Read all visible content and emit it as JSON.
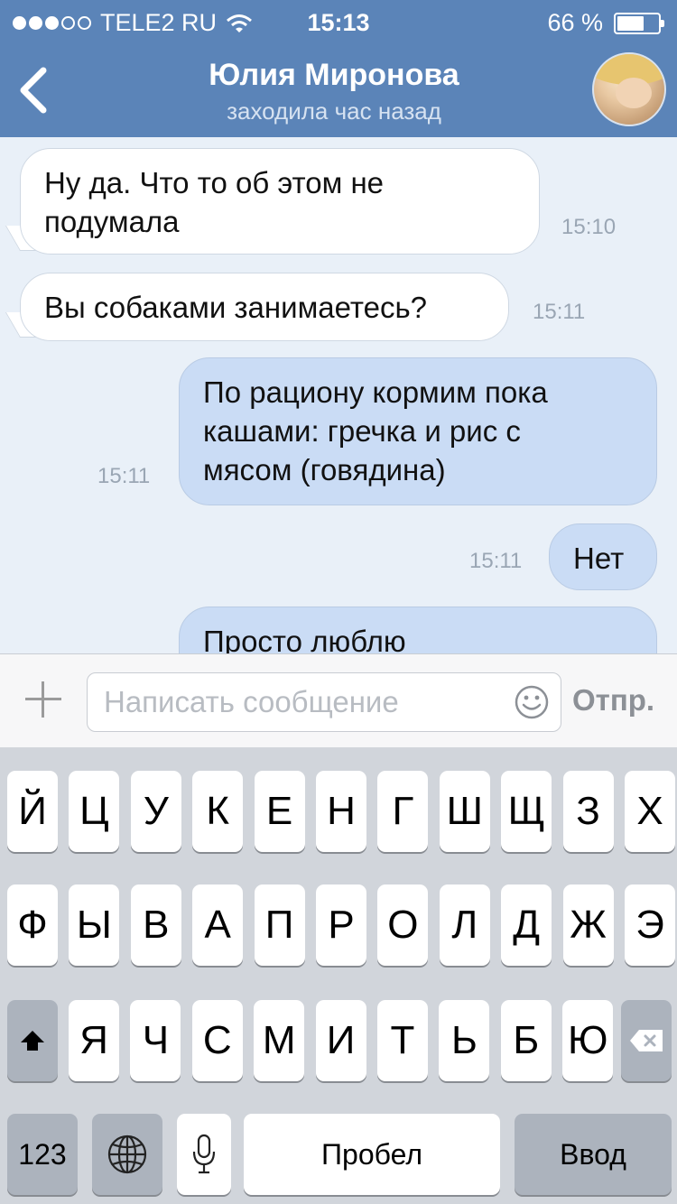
{
  "status_bar": {
    "carrier": "TELE2 RU",
    "time": "15:13",
    "battery": "66 %",
    "signal_filled": 3,
    "signal_total": 5,
    "battery_level": 0.66
  },
  "header": {
    "back_icon": "chevron-left-icon",
    "name": "Юлия Миронова",
    "last_seen": "заходила час назад",
    "accent": "#5b84b8"
  },
  "messages": [
    {
      "direction": "in",
      "lines": [
        "Ну да. Что то об этом не",
        "подумала"
      ],
      "time": "15:10"
    },
    {
      "direction": "in",
      "lines": [
        "Вы собаками занимаетесь?"
      ],
      "time": "15:11"
    },
    {
      "direction": "out",
      "lines": [
        "По рациону кормим пока",
        "кашами: гречка и рис с",
        "мясом (говядина)"
      ],
      "time": "15:11"
    },
    {
      "direction": "out",
      "lines": [
        "Нет"
      ],
      "time": "15:11"
    },
    {
      "direction": "out",
      "lines": [
        "Просто люблю"
      ],
      "time": ""
    }
  ],
  "composer": {
    "placeholder": "Написать сообщение",
    "send_label": "Отпр.",
    "attach_icon": "plus-icon",
    "emoji_icon": "smiley-icon"
  },
  "keyboard": {
    "row1": [
      "Й",
      "Ц",
      "У",
      "К",
      "Е",
      "Н",
      "Г",
      "Ш",
      "Щ",
      "З",
      "Х"
    ],
    "row2": [
      "Ф",
      "Ы",
      "В",
      "А",
      "П",
      "Р",
      "О",
      "Л",
      "Д",
      "Ж",
      "Э"
    ],
    "row3": [
      "Я",
      "Ч",
      "С",
      "М",
      "И",
      "Т",
      "Ь",
      "Б",
      "Ю"
    ],
    "numbers_label": "123",
    "space_label": "Пробел",
    "return_label": "Ввод",
    "shift_icon": "shift-icon",
    "delete_icon": "backspace-icon",
    "globe_icon": "globe-icon",
    "mic_icon": "microphone-icon"
  }
}
